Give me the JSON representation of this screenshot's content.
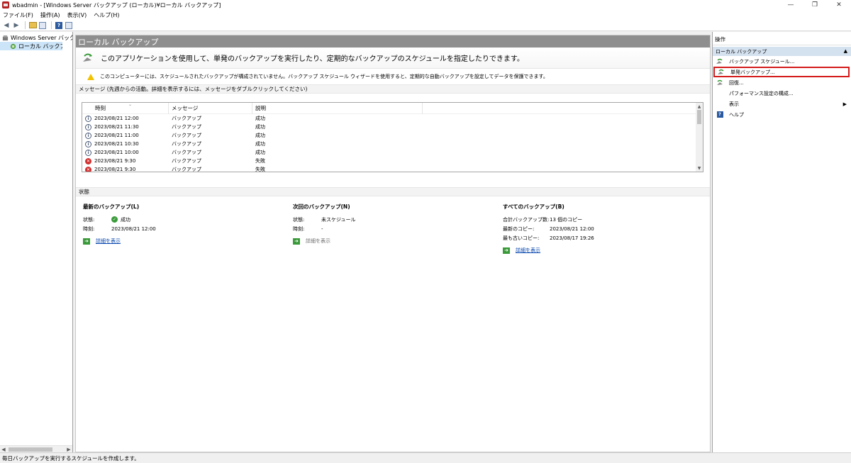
{
  "window": {
    "title": "wbadmin - [Windows Server バックアップ (ローカル)¥ローカル バックアップ]",
    "minimize": "—",
    "restore": "❐",
    "close": "✕"
  },
  "menu": [
    "ファイル(F)",
    "操作(A)",
    "表示(V)",
    "ヘルプ(H)"
  ],
  "tree": {
    "root": "Windows Server バックアップ",
    "child": "ローカル バックアップ"
  },
  "center": {
    "header": "ローカル バックアップ",
    "intro": "このアプリケーションを使用して、単発のバックアップを実行したり、定期的なバックアップのスケジュールを指定したりできます。",
    "warning": "このコンピューターには、スケジュールされたバックアップが構成されていません。バックアップ スケジュール ウィザードを使用すると、定期的な自動バックアップを設定してデータを保護できます。",
    "messages_label": "メッセージ (先週からの活動。詳細を表示するには、メッセージをダブルクリックしてください)",
    "columns": [
      "時刻",
      "メッセージ",
      "説明"
    ],
    "rows": [
      {
        "type": "info",
        "time": "2023/08/21 12:00",
        "message": "バックアップ",
        "desc": "成功"
      },
      {
        "type": "info",
        "time": "2023/08/21 11:30",
        "message": "バックアップ",
        "desc": "成功"
      },
      {
        "type": "info",
        "time": "2023/08/21 11:00",
        "message": "バックアップ",
        "desc": "成功"
      },
      {
        "type": "info",
        "time": "2023/08/21 10:30",
        "message": "バックアップ",
        "desc": "成功"
      },
      {
        "type": "info",
        "time": "2023/08/21 10:00",
        "message": "バックアップ",
        "desc": "成功"
      },
      {
        "type": "error",
        "time": "2023/08/21 9:30",
        "message": "バックアップ",
        "desc": "失敗"
      },
      {
        "type": "error",
        "time": "2023/08/21 9:30",
        "message": "バックアップ",
        "desc": "失敗"
      }
    ],
    "status_label": "状態",
    "latest": {
      "title": "最新のバックアップ(L)",
      "status_key": "状態:",
      "status_val": "成功",
      "time_key": "時刻:",
      "time_val": "2023/08/21 12:00",
      "link": "詳細を表示"
    },
    "next": {
      "title": "次回のバックアップ(N)",
      "status_key": "状態:",
      "status_val": "未スケジュール",
      "time_key": "時刻:",
      "time_val": "-",
      "link": "詳細を表示"
    },
    "all": {
      "title": "すべてのバックアップ(B)",
      "total_key": "合計バックアップ数:",
      "total_val": "13 個のコピー",
      "newest_key": "最新のコピー:",
      "newest_val": "2023/08/21 12:00",
      "oldest_key": "最も古いコピー:",
      "oldest_val": "2023/08/17 19:26",
      "link": "詳細を表示"
    }
  },
  "actions": {
    "header": "操作",
    "group": "ローカル バックアップ",
    "items": [
      "バックアップ スケジュール...",
      "単発バックアップ...",
      "回復...",
      "パフォーマンス設定の構成...",
      "表示",
      "ヘルプ"
    ]
  },
  "statusbar": "毎日バックアップを実行するスケジュールを作成します。",
  "colors": {
    "header_bg": "#8e8e8e",
    "highlight_border": "#d51b1b",
    "actions_group_bg": "#d4e1ef",
    "link": "#0645ad"
  }
}
